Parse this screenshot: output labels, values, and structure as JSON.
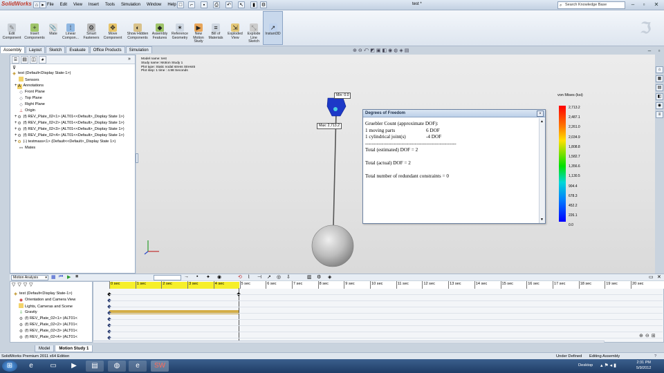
{
  "app": {
    "logo": "SolidWorks",
    "document_title": "test *",
    "menu": [
      "File",
      "Edit",
      "View",
      "Insert",
      "Tools",
      "Simulation",
      "Window",
      "Help"
    ],
    "search_placeholder": "Search Knowledge Base"
  },
  "toolbar": {
    "tools": [
      {
        "label": "Edit Component",
        "icon": "edit-component-icon"
      },
      {
        "label": "Insert Components",
        "icon": "insert-components-icon"
      },
      {
        "label": "Mate",
        "icon": "mate-icon"
      },
      {
        "label": "Linear Compon...",
        "icon": "linear-pattern-icon"
      },
      {
        "label": "Smart Fasteners",
        "icon": "smart-fasteners-icon"
      },
      {
        "label": "Move Component",
        "icon": "move-component-icon"
      },
      {
        "label": "Show Hidden Components",
        "icon": "show-hidden-icon"
      },
      {
        "label": "Assembly Features",
        "icon": "assembly-features-icon"
      },
      {
        "label": "Reference Geometry",
        "icon": "reference-geometry-icon"
      },
      {
        "label": "New Motion Study",
        "icon": "new-motion-study-icon"
      },
      {
        "label": "Bill of Materials",
        "icon": "bom-icon"
      },
      {
        "label": "Exploded View",
        "icon": "exploded-view-icon"
      },
      {
        "label": "Explode Line Sketch",
        "icon": "explode-line-icon"
      },
      {
        "label": "Instant3D",
        "icon": "instant3d-icon"
      }
    ]
  },
  "tabs": [
    "Assembly",
    "Layout",
    "Sketch",
    "Evaluate",
    "Office Products",
    "Simulation"
  ],
  "feature_tree": [
    {
      "label": "test  (Default<Display State-1>)",
      "icon": "assembly-icon",
      "indent": 0
    },
    {
      "label": "Sensors",
      "icon": "sensors-folder-icon",
      "indent": 1
    },
    {
      "label": "Annotations",
      "icon": "annotations-icon",
      "indent": 1
    },
    {
      "label": "Front Plane",
      "icon": "plane-icon",
      "indent": 1
    },
    {
      "label": "Top Plane",
      "icon": "plane-icon",
      "indent": 1
    },
    {
      "label": "Right Plane",
      "icon": "plane-icon",
      "indent": 1
    },
    {
      "label": "Origin",
      "icon": "origin-icon",
      "indent": 1
    },
    {
      "label": "(f) REV_Plate_02<1> (ALT01<<Default>_Display State 1>)",
      "icon": "part-icon",
      "indent": 1
    },
    {
      "label": "(f) REV_Plate_02<2> (ALT01<<Default>_Display State 1>)",
      "icon": "part-icon",
      "indent": 1
    },
    {
      "label": "(f) REV_Plate_02<3> (ALT01<<Default>_Display State 1>)",
      "icon": "part-icon",
      "indent": 1
    },
    {
      "label": "(f) REV_Plate_02<4> (ALT01<<Default>_Display State 1>)",
      "icon": "part-icon",
      "indent": 1
    },
    {
      "label": "(-) testmass<1> (Default<<Default>_Display State 1>)",
      "icon": "part-icon",
      "indent": 1
    },
    {
      "label": "Mates",
      "icon": "mates-folder-icon",
      "indent": 1
    }
  ],
  "study_info": {
    "model_name": "Model name: test",
    "study_name": "Study name: Motion Study 1",
    "plot_type": "Plot type: Static nodal stress Stress5",
    "plot_step": "Plot step: 1   time : 4.98 Seconds"
  },
  "plot_tags": {
    "min": "Min: 0.0",
    "max": "Max: 2,713.2"
  },
  "dof_dialog": {
    "title": "Degrees of Freedom",
    "lines": [
      "Gruebler Count (approximate DOF):",
      "1 moving parts                  6 DOF",
      "1 cylindrical joint(s)          -4 DOF",
      "-------------------------------------------------------",
      "Total (estimated) DOF = 2",
      "",
      "Total (actual) DOF = 2",
      "",
      "Total number of redundant constraints = 0"
    ]
  },
  "legend": {
    "title": "von Mises (ksi)",
    "labels": [
      "2,713.2",
      "2,487.1",
      "2,261.0",
      "2,034.9",
      "1,808.8",
      "1,582.7",
      "1,356.6",
      "1,130.5",
      "904.4",
      "678.3",
      "452.2",
      "226.1",
      "0.0"
    ]
  },
  "motion_manager": {
    "study_type": "Motion Analysis",
    "time_ticks": [
      "0 sec",
      "1 sec",
      "2 sec",
      "3 sec",
      "4 sec",
      "5 sec",
      "6 sec",
      "7 sec",
      "8 sec",
      "9 sec",
      "10 sec",
      "11 sec",
      "12 sec",
      "13 sec",
      "14 sec",
      "15 sec",
      "16 sec",
      "17 sec",
      "18 sec",
      "19 sec",
      "20 sec"
    ],
    "tree": [
      "test  (Default<Display State-1>)",
      "Orientation and Camera View",
      "Lights, Cameras and Scene",
      "Gravity",
      "(f) REV_Plate_02<1> (ALT01<",
      "(f) REV_Plate_02<2> (ALT01<",
      "(f) REV_Plate_02<3> (ALT01<",
      "(f) REV_Plate_02<4> (ALT01<"
    ],
    "bottom_tabs": [
      "Model",
      "Motion Study 1"
    ]
  },
  "status": {
    "left": "SolidWorks Premium 2011 x64 Edition",
    "under_defined": "Under Defined",
    "mode": "Editing Assembly"
  },
  "taskbar": {
    "desktop": "Desktop",
    "time": "2:31 PM",
    "date": "5/9/2012"
  }
}
